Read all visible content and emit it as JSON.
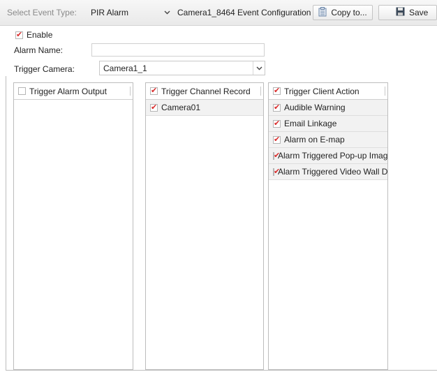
{
  "toolbar": {
    "select_event_type_label": "Select Event Type:",
    "event_type_value": "PIR Alarm",
    "configuration_title": "Camera1_8464 Event Configuration",
    "copy_button_label": "Copy to...",
    "save_button_label": "Save"
  },
  "form": {
    "enable_label": "Enable",
    "enable_checked": true,
    "alarm_name_label": "Alarm Name:",
    "alarm_name_value": "",
    "trigger_camera_label": "Trigger Camera:",
    "trigger_camera_value": "Camera1_1"
  },
  "panels": {
    "alarm_output": {
      "header": "Trigger Alarm Output",
      "checked": false,
      "items": []
    },
    "channel_record": {
      "header": "Trigger Channel Record",
      "checked": true,
      "items": [
        {
          "label": "Camera01",
          "checked": true
        }
      ]
    },
    "client_action": {
      "header": "Trigger Client Action",
      "checked": true,
      "items": [
        {
          "label": "Audible Warning",
          "checked": true
        },
        {
          "label": "Email Linkage",
          "checked": true
        },
        {
          "label": "Alarm on E-map",
          "checked": true
        },
        {
          "label": "Alarm Triggered Pop-up Image",
          "checked": true
        },
        {
          "label": "Alarm Triggered Video Wall Di...",
          "checked": true
        }
      ]
    }
  },
  "colors": {
    "check_mark": "#d92b2b",
    "toolbar_bg": "#ececec",
    "row_bg": "#f2f2f2"
  }
}
